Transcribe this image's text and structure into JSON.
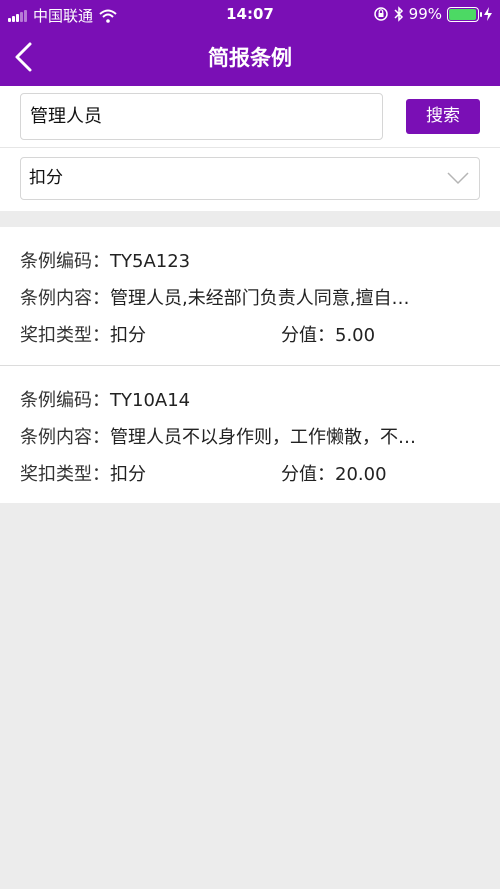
{
  "status_bar": {
    "carrier": "中国联通",
    "time": "14:07",
    "battery": "99%"
  },
  "nav": {
    "title": "简报条例"
  },
  "search": {
    "value": "管理人员",
    "button_label": "搜索"
  },
  "filter": {
    "selected": "扣分"
  },
  "labels": {
    "code": "条例编码：",
    "content": "条例内容：",
    "type": "奖扣类型：",
    "score": "分值："
  },
  "items": [
    {
      "code": "TY5A123",
      "content": "管理人员,未经部门负责人同意,擅自…",
      "type": "扣分",
      "score": "5.00"
    },
    {
      "code": "TY10A14",
      "content": "管理人员不以身作则，工作懒散，不…",
      "type": "扣分",
      "score": "20.00"
    }
  ],
  "colors": {
    "brand": "#7a0fb5",
    "battery": "#4cd964"
  }
}
